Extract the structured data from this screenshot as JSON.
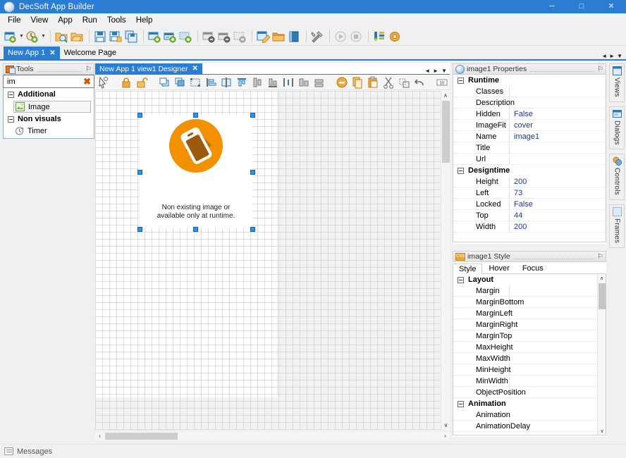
{
  "window": {
    "title": "DecSoft App Builder",
    "icon": "app-globe-icon",
    "minimize": "─",
    "maximize": "□",
    "close": "✕",
    "accent": "#2b7cd3"
  },
  "menubar": {
    "items": [
      {
        "label": "File"
      },
      {
        "label": "View"
      },
      {
        "label": "App"
      },
      {
        "label": "Run"
      },
      {
        "label": "Tools"
      },
      {
        "label": "Help"
      }
    ]
  },
  "toolbar": {
    "groups": [
      {
        "items": [
          {
            "name": "new-app-icon",
            "dropdown": true
          },
          {
            "name": "open-recent-icon",
            "dropdown": true
          }
        ]
      },
      {
        "items": [
          {
            "name": "open-app-icon"
          },
          {
            "name": "open-folder-icon"
          }
        ]
      },
      {
        "items": [
          {
            "name": "save-icon"
          },
          {
            "name": "save-as-icon"
          },
          {
            "name": "save-all-icon"
          }
        ]
      },
      {
        "items": [
          {
            "name": "add-view-icon"
          },
          {
            "name": "add-dialog-icon"
          },
          {
            "name": "add-frame-icon"
          }
        ]
      },
      {
        "items": [
          {
            "name": "remove-view-icon"
          },
          {
            "name": "remove-dialog-icon"
          },
          {
            "name": "remove-frame-icon"
          }
        ]
      },
      {
        "items": [
          {
            "name": "edit-code-icon"
          },
          {
            "name": "resources-folder-icon"
          },
          {
            "name": "book-icon"
          }
        ]
      },
      {
        "items": [
          {
            "name": "build-tools-icon"
          }
        ]
      },
      {
        "items": [
          {
            "name": "run-icon",
            "disabled": true
          },
          {
            "name": "stop-icon",
            "disabled": true
          }
        ]
      },
      {
        "items": [
          {
            "name": "update-icon"
          },
          {
            "name": "extensions-icon"
          }
        ]
      }
    ]
  },
  "doc_tabs": {
    "tabs": [
      {
        "label": "New App 1",
        "active": true,
        "closable": true
      },
      {
        "label": "Welcome Page",
        "active": false,
        "closable": false
      }
    ],
    "nav_prev": "◄",
    "nav_next": "►",
    "nav_menu": "▼"
  },
  "tools_panel": {
    "title": "Tools",
    "icon": "tools-palette-icon",
    "pin": "⚐",
    "search": {
      "value": "im",
      "placeholder": "",
      "clear_icon": "clear-x-icon",
      "clear_glyph": "✖"
    },
    "groups": [
      {
        "label": "Additional",
        "items": [
          {
            "label": "Image",
            "icon": "image-tool-icon",
            "selected": true
          }
        ]
      },
      {
        "label": "Non visuals",
        "items": [
          {
            "label": "Timer",
            "icon": "timer-tool-icon",
            "selected": false
          }
        ]
      }
    ]
  },
  "designer": {
    "tab": {
      "label": "New App 1 view1 Designer",
      "close": "✕"
    },
    "nav_prev": "◄",
    "nav_next": "►",
    "nav_menu": "▼",
    "toolbar_items": [
      {
        "name": "select-pointer-icon"
      },
      {
        "name": "lock-controls-icon"
      },
      {
        "name": "unlock-controls-icon"
      },
      {
        "name": "bring-to-front-icon"
      },
      {
        "name": "send-to-back-icon"
      },
      {
        "name": "size-to-grid-icon"
      },
      {
        "name": "align-left-icon"
      },
      {
        "name": "align-center-icon"
      },
      {
        "name": "align-top-icon"
      },
      {
        "name": "align-middle-icon"
      },
      {
        "name": "align-bottom-icon"
      },
      {
        "name": "space-horizontally-icon"
      },
      {
        "name": "space-vertically-icon"
      },
      {
        "name": "make-same-width-icon"
      },
      {
        "name": "make-same-height-icon"
      },
      {
        "name": "delete-control-icon"
      },
      {
        "name": "copy-control-icon"
      },
      {
        "name": "paste-control-icon"
      },
      {
        "name": "cut-control-icon"
      },
      {
        "name": "duplicate-control-icon"
      },
      {
        "name": "undo-icon"
      },
      {
        "name": "grid-size-icon"
      }
    ],
    "control": {
      "name": "image1",
      "placeholder_line1": "Non existing image or",
      "placeholder_line2": "available only at runtime.",
      "logo_icon": "appbuilder-orange-device-icon",
      "logo_bg": "#f29100",
      "logo_fg": "#ffffff",
      "logo_shadow": "#9c5a0c"
    },
    "handles": 8,
    "vscroll": {
      "up": "∧",
      "down": "∨"
    },
    "hscroll": {
      "left": "‹",
      "right": "›"
    }
  },
  "properties_panel": {
    "title": "image1 Properties",
    "icon": "properties-globe-icon",
    "pin": "⚐",
    "categories": [
      {
        "label": "Runtime",
        "rows": [
          {
            "name": "Classes",
            "value": ""
          },
          {
            "name": "Description",
            "value": ""
          },
          {
            "name": "Hidden",
            "value": "False"
          },
          {
            "name": "ImageFit",
            "value": "cover"
          },
          {
            "name": "Name",
            "value": "image1"
          },
          {
            "name": "Title",
            "value": ""
          },
          {
            "name": "Url",
            "value": ""
          }
        ]
      },
      {
        "label": "Designtime",
        "rows": [
          {
            "name": "Height",
            "value": "200"
          },
          {
            "name": "Left",
            "value": "73"
          },
          {
            "name": "Locked",
            "value": "False"
          },
          {
            "name": "Top",
            "value": "44"
          },
          {
            "name": "Width",
            "value": "200"
          }
        ]
      }
    ]
  },
  "style_panel": {
    "title": "image1 Style",
    "icon": "css-icon",
    "icon_text": "CSS",
    "pin": "⚐",
    "tabs": [
      {
        "label": "Style",
        "active": true
      },
      {
        "label": "Hover",
        "active": false
      },
      {
        "label": "Focus",
        "active": false
      }
    ],
    "categories": [
      {
        "label": "Layout",
        "rows": [
          {
            "name": "Margin",
            "value": ""
          },
          {
            "name": "MarginBottom",
            "value": ""
          },
          {
            "name": "MarginLeft",
            "value": ""
          },
          {
            "name": "MarginRight",
            "value": ""
          },
          {
            "name": "MarginTop",
            "value": ""
          },
          {
            "name": "MaxHeight",
            "value": ""
          },
          {
            "name": "MaxWidth",
            "value": ""
          },
          {
            "name": "MinHeight",
            "value": ""
          },
          {
            "name": "MinWidth",
            "value": ""
          },
          {
            "name": "ObjectPosition",
            "value": ""
          }
        ]
      },
      {
        "label": "Animation",
        "rows": [
          {
            "name": "Animation",
            "value": ""
          },
          {
            "name": "AnimationDelay",
            "value": ""
          }
        ]
      }
    ],
    "vscroll": {
      "up": "∧",
      "down": "∨"
    }
  },
  "vertical_tabs": [
    {
      "label": "Views",
      "icon": "views-icon"
    },
    {
      "label": "Dialogs",
      "icon": "dialogs-icon"
    },
    {
      "label": "Controls",
      "icon": "controls-icon"
    },
    {
      "label": "Frames",
      "icon": "frames-icon"
    }
  ],
  "statusbar": {
    "messages_label": "Messages",
    "messages_icon": "messages-icon"
  }
}
